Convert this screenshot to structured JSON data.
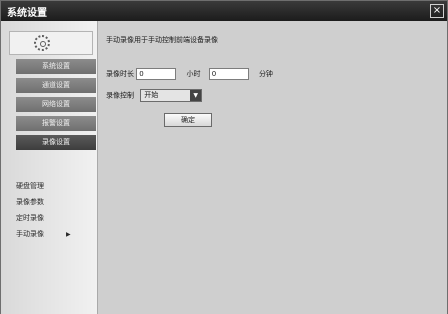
{
  "window": {
    "title": "系统设置",
    "close_glyph": "×"
  },
  "sidebar": {
    "gear_icon": "gear-icon",
    "items": [
      {
        "label": "系统设置"
      },
      {
        "label": "通道设置"
      },
      {
        "label": "网络设置"
      },
      {
        "label": "报警设置"
      },
      {
        "label": "录像设置"
      }
    ],
    "subitems": [
      {
        "label": "硬盘管理"
      },
      {
        "label": "录像参数"
      },
      {
        "label": "定时录像"
      },
      {
        "label": "手动录像",
        "arrow": "▶"
      }
    ]
  },
  "main": {
    "description": "手动录像用于手动控制前端设备录像",
    "duration_label": "录像时长",
    "hours_value": "0",
    "hours_unit": "小时",
    "minutes_value": "0",
    "minutes_unit": "分钟",
    "control_label": "录像控制",
    "control_value": "开始",
    "confirm_label": "确定"
  }
}
